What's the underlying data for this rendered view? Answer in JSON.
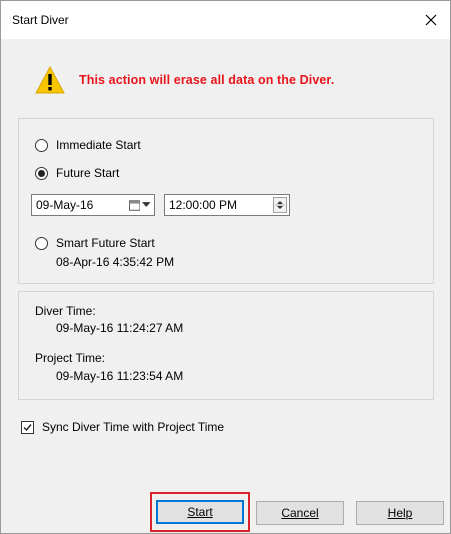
{
  "window": {
    "title": "Start Diver"
  },
  "warning": {
    "text": "This action will erase all data on the Diver."
  },
  "start_options": {
    "immediate_label": "Immediate Start",
    "future_label": "Future Start",
    "selected": "Future Start",
    "date_value": "09-May-16",
    "time_value": "12:00:00 PM",
    "smart_label": "Smart Future Start",
    "smart_time": "08-Apr-16 4:35:42 PM"
  },
  "times": {
    "diver_label": "Diver Time:",
    "diver_value": "09-May-16 11:24:27 AM",
    "project_label": "Project Time:",
    "project_value": "09-May-16 11:23:54 AM"
  },
  "sync": {
    "label": "Sync Diver Time with Project Time",
    "checked": true
  },
  "buttons": {
    "start": "Start",
    "cancel": "Cancel",
    "help": "Help"
  },
  "icons": {
    "warning": "warning-icon",
    "close": "close-icon",
    "calendar": "calendar-icon",
    "spinner": "spinner-icon"
  },
  "colors": {
    "warning_text": "#e8141c",
    "highlight": "#d8232a",
    "warning_icon": "#f7c600"
  }
}
